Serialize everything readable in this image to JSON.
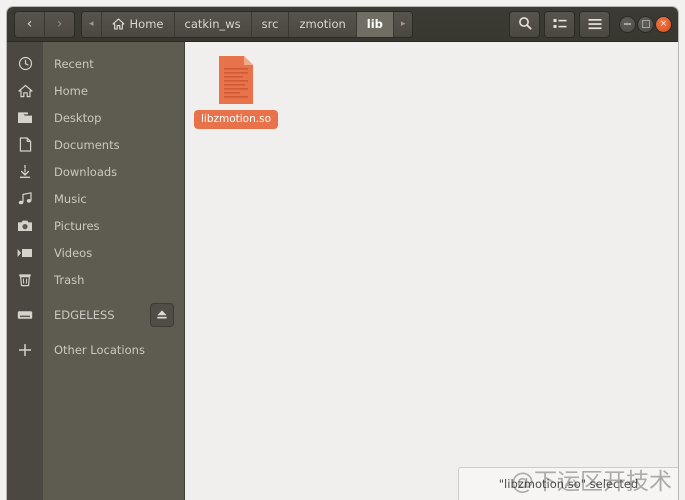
{
  "window": {
    "controls": {
      "minimize": "minimize",
      "maximize": "maximize",
      "close": "×"
    }
  },
  "toolbar": {
    "back_label": "‹",
    "forward_label": "›",
    "crumb_prev_label": "◂",
    "crumb_next_label": "▸",
    "search_label": "search-icon",
    "view_grid_label": "view-list-icon",
    "menu_label": "☰",
    "breadcrumbs": [
      {
        "label": "Home",
        "icon": "home-icon",
        "active": false
      },
      {
        "label": "catkin_ws",
        "icon": "",
        "active": false
      },
      {
        "label": "src",
        "icon": "",
        "active": false
      },
      {
        "label": "zmotion",
        "icon": "",
        "active": false
      },
      {
        "label": "lib",
        "icon": "",
        "active": true
      }
    ]
  },
  "sidebar": {
    "items": [
      {
        "label": "Recent",
        "icon": "clock-icon",
        "eject": false
      },
      {
        "label": "Home",
        "icon": "home-icon",
        "eject": false
      },
      {
        "label": "Desktop",
        "icon": "folder-icon",
        "eject": false
      },
      {
        "label": "Documents",
        "icon": "document-icon",
        "eject": false
      },
      {
        "label": "Downloads",
        "icon": "download-icon",
        "eject": false
      },
      {
        "label": "Music",
        "icon": "music-icon",
        "eject": false
      },
      {
        "label": "Pictures",
        "icon": "camera-icon",
        "eject": false
      },
      {
        "label": "Videos",
        "icon": "video-icon",
        "eject": false
      },
      {
        "label": "Trash",
        "icon": "trash-icon",
        "eject": false
      },
      {
        "label": "EDGELESS",
        "icon": "drive-icon",
        "eject": true
      },
      {
        "label": "Other Locations",
        "icon": "plus-icon",
        "eject": false
      }
    ]
  },
  "main": {
    "files": [
      {
        "name": "libzmotion.so",
        "icon": "file-code-icon",
        "selected": true
      }
    ]
  },
  "statusbar": {
    "text": "\"libzmotion.so\" selected"
  },
  "watermark": {
    "text": "@下运区开技术"
  },
  "colors": {
    "accent_orange": "#e8734a",
    "headerbar": "#3a3932",
    "sidebar_bg": "#5e5c50",
    "sidebar_strip": "#4a4840",
    "main_bg": "#f0efee",
    "close_button": "#de4c17"
  }
}
